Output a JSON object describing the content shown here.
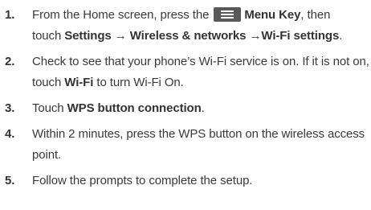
{
  "steps": [
    {
      "number": "1.",
      "line1_prefix": "From the Home screen, press the",
      "icon": "menu-key-icon",
      "menu_key": "Menu Key",
      "line1_suffix": ", then",
      "line2_prefix": "touch",
      "settings": "Settings",
      "arrow1": "→",
      "wireless": "Wireless & networks",
      "arrow2": "→",
      "wifi_settings": "Wi-Fi settings",
      "line2_suffix": "."
    },
    {
      "number": "2.",
      "text_before": "Check to see that your phone’s Wi-Fi service is on. If it is not on, touch",
      "wifi": "Wi-Fi",
      "text_after": "to turn Wi-Fi On."
    },
    {
      "number": "3.",
      "text_before": "Touch",
      "wps": "WPS button connection",
      "text_after": "."
    },
    {
      "number": "4.",
      "text": "Within 2 minutes, press the WPS button on the wireless access point."
    },
    {
      "number": "5.",
      "text": "Follow the prompts to complete the setup."
    }
  ]
}
